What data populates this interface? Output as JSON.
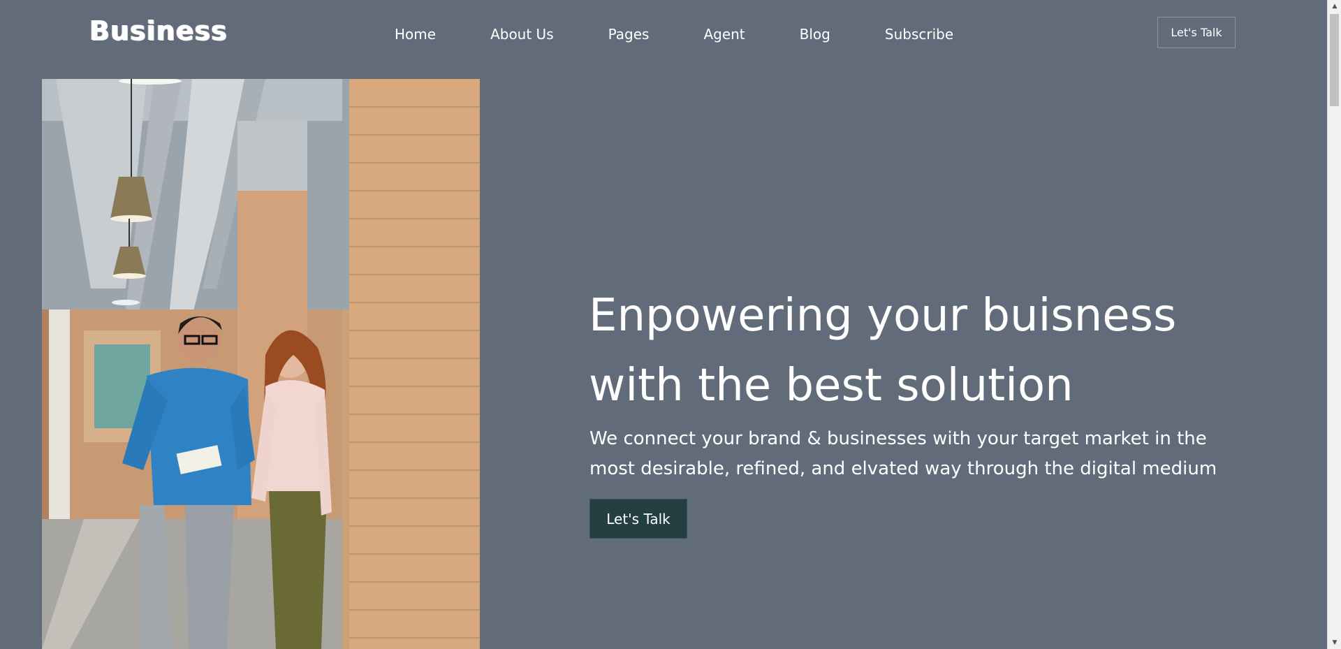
{
  "header": {
    "logo": "Business",
    "nav": [
      "Home",
      "About Us",
      "Pages",
      "Agent",
      "Blog",
      "Subscribe"
    ],
    "cta_label": "Let's Talk"
  },
  "hero": {
    "image_icon": "office-people-photo",
    "title_line1": "Enpowering your buisness",
    "title_line2": "with the best solution",
    "subtitle_line1": "We connect your brand & businesses with your target market in the",
    "subtitle_line2": "most desirable, refined, and elvated way through the digital medium",
    "cta_label": "Let's Talk"
  },
  "scrollbar": {
    "up_icon": "▲",
    "down_icon": "▼"
  },
  "colors": {
    "background": "#616b79",
    "button_dark": "#243f42",
    "text": "#ffffff"
  }
}
